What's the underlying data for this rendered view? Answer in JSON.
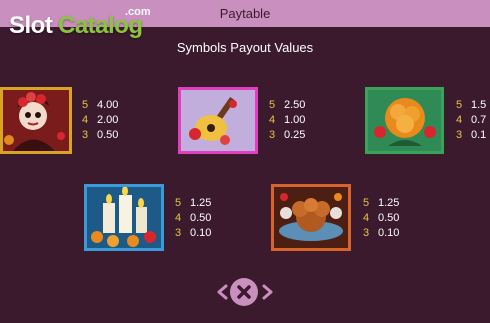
{
  "header": {
    "title": "Paytable"
  },
  "logo": {
    "slot": "Slot",
    "catalog": "Catalog",
    "com": ".com"
  },
  "subtitle": "Symbols Payout Values",
  "symbols": [
    {
      "icon": "catrina-woman-icon",
      "pays": [
        {
          "count": "5",
          "value": "4.00"
        },
        {
          "count": "4",
          "value": "2.00"
        },
        {
          "count": "3",
          "value": "0.50"
        }
      ]
    },
    {
      "icon": "guitar-icon",
      "pays": [
        {
          "count": "5",
          "value": "2.50"
        },
        {
          "count": "4",
          "value": "1.00"
        },
        {
          "count": "3",
          "value": "0.25"
        }
      ]
    },
    {
      "icon": "marigold-icon",
      "pays": [
        {
          "count": "5",
          "value": "1.5"
        },
        {
          "count": "4",
          "value": "0.7"
        },
        {
          "count": "3",
          "value": "0.1"
        }
      ]
    },
    {
      "icon": "candles-icon",
      "pays": [
        {
          "count": "5",
          "value": "1.25"
        },
        {
          "count": "4",
          "value": "0.50"
        },
        {
          "count": "3",
          "value": "0.10"
        }
      ]
    },
    {
      "icon": "pan-de-muerto-icon",
      "pays": [
        {
          "count": "5",
          "value": "1.25"
        },
        {
          "count": "4",
          "value": "0.50"
        },
        {
          "count": "3",
          "value": "0.10"
        }
      ]
    }
  ],
  "colors": {
    "background": "#3a1a2c",
    "topbar": "#c98fbf",
    "count_color": "#e8c545",
    "value_color": "#ffffff",
    "frame_gold": "#d9a324",
    "frame_pink": "#e040c0",
    "frame_green": "#3aa35a",
    "frame_blue": "#3b9bd8",
    "frame_orange": "#d9642a"
  },
  "controls": {
    "close_icon": "close-icon",
    "prev_icon": "arrow-left-icon",
    "next_icon": "arrow-right-icon"
  }
}
